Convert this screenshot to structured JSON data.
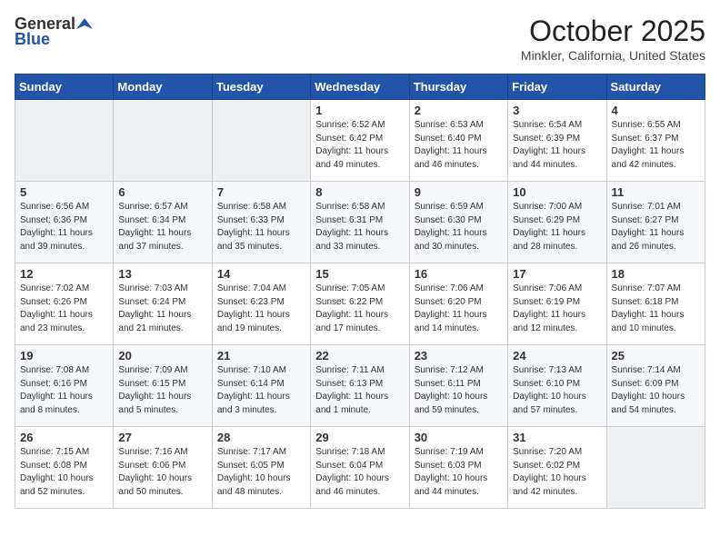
{
  "logo": {
    "general": "General",
    "blue": "Blue"
  },
  "title": "October 2025",
  "location": "Minkler, California, United States",
  "days_of_week": [
    "Sunday",
    "Monday",
    "Tuesday",
    "Wednesday",
    "Thursday",
    "Friday",
    "Saturday"
  ],
  "weeks": [
    [
      {
        "day": "",
        "info": ""
      },
      {
        "day": "",
        "info": ""
      },
      {
        "day": "",
        "info": ""
      },
      {
        "day": "1",
        "info": "Sunrise: 6:52 AM\nSunset: 6:42 PM\nDaylight: 11 hours\nand 49 minutes."
      },
      {
        "day": "2",
        "info": "Sunrise: 6:53 AM\nSunset: 6:40 PM\nDaylight: 11 hours\nand 46 minutes."
      },
      {
        "day": "3",
        "info": "Sunrise: 6:54 AM\nSunset: 6:39 PM\nDaylight: 11 hours\nand 44 minutes."
      },
      {
        "day": "4",
        "info": "Sunrise: 6:55 AM\nSunset: 6:37 PM\nDaylight: 11 hours\nand 42 minutes."
      }
    ],
    [
      {
        "day": "5",
        "info": "Sunrise: 6:56 AM\nSunset: 6:36 PM\nDaylight: 11 hours\nand 39 minutes."
      },
      {
        "day": "6",
        "info": "Sunrise: 6:57 AM\nSunset: 6:34 PM\nDaylight: 11 hours\nand 37 minutes."
      },
      {
        "day": "7",
        "info": "Sunrise: 6:58 AM\nSunset: 6:33 PM\nDaylight: 11 hours\nand 35 minutes."
      },
      {
        "day": "8",
        "info": "Sunrise: 6:58 AM\nSunset: 6:31 PM\nDaylight: 11 hours\nand 33 minutes."
      },
      {
        "day": "9",
        "info": "Sunrise: 6:59 AM\nSunset: 6:30 PM\nDaylight: 11 hours\nand 30 minutes."
      },
      {
        "day": "10",
        "info": "Sunrise: 7:00 AM\nSunset: 6:29 PM\nDaylight: 11 hours\nand 28 minutes."
      },
      {
        "day": "11",
        "info": "Sunrise: 7:01 AM\nSunset: 6:27 PM\nDaylight: 11 hours\nand 26 minutes."
      }
    ],
    [
      {
        "day": "12",
        "info": "Sunrise: 7:02 AM\nSunset: 6:26 PM\nDaylight: 11 hours\nand 23 minutes."
      },
      {
        "day": "13",
        "info": "Sunrise: 7:03 AM\nSunset: 6:24 PM\nDaylight: 11 hours\nand 21 minutes."
      },
      {
        "day": "14",
        "info": "Sunrise: 7:04 AM\nSunset: 6:23 PM\nDaylight: 11 hours\nand 19 minutes."
      },
      {
        "day": "15",
        "info": "Sunrise: 7:05 AM\nSunset: 6:22 PM\nDaylight: 11 hours\nand 17 minutes."
      },
      {
        "day": "16",
        "info": "Sunrise: 7:06 AM\nSunset: 6:20 PM\nDaylight: 11 hours\nand 14 minutes."
      },
      {
        "day": "17",
        "info": "Sunrise: 7:06 AM\nSunset: 6:19 PM\nDaylight: 11 hours\nand 12 minutes."
      },
      {
        "day": "18",
        "info": "Sunrise: 7:07 AM\nSunset: 6:18 PM\nDaylight: 11 hours\nand 10 minutes."
      }
    ],
    [
      {
        "day": "19",
        "info": "Sunrise: 7:08 AM\nSunset: 6:16 PM\nDaylight: 11 hours\nand 8 minutes."
      },
      {
        "day": "20",
        "info": "Sunrise: 7:09 AM\nSunset: 6:15 PM\nDaylight: 11 hours\nand 5 minutes."
      },
      {
        "day": "21",
        "info": "Sunrise: 7:10 AM\nSunset: 6:14 PM\nDaylight: 11 hours\nand 3 minutes."
      },
      {
        "day": "22",
        "info": "Sunrise: 7:11 AM\nSunset: 6:13 PM\nDaylight: 11 hours\nand 1 minute."
      },
      {
        "day": "23",
        "info": "Sunrise: 7:12 AM\nSunset: 6:11 PM\nDaylight: 10 hours\nand 59 minutes."
      },
      {
        "day": "24",
        "info": "Sunrise: 7:13 AM\nSunset: 6:10 PM\nDaylight: 10 hours\nand 57 minutes."
      },
      {
        "day": "25",
        "info": "Sunrise: 7:14 AM\nSunset: 6:09 PM\nDaylight: 10 hours\nand 54 minutes."
      }
    ],
    [
      {
        "day": "26",
        "info": "Sunrise: 7:15 AM\nSunset: 6:08 PM\nDaylight: 10 hours\nand 52 minutes."
      },
      {
        "day": "27",
        "info": "Sunrise: 7:16 AM\nSunset: 6:06 PM\nDaylight: 10 hours\nand 50 minutes."
      },
      {
        "day": "28",
        "info": "Sunrise: 7:17 AM\nSunset: 6:05 PM\nDaylight: 10 hours\nand 48 minutes."
      },
      {
        "day": "29",
        "info": "Sunrise: 7:18 AM\nSunset: 6:04 PM\nDaylight: 10 hours\nand 46 minutes."
      },
      {
        "day": "30",
        "info": "Sunrise: 7:19 AM\nSunset: 6:03 PM\nDaylight: 10 hours\nand 44 minutes."
      },
      {
        "day": "31",
        "info": "Sunrise: 7:20 AM\nSunset: 6:02 PM\nDaylight: 10 hours\nand 42 minutes."
      },
      {
        "day": "",
        "info": ""
      }
    ]
  ]
}
